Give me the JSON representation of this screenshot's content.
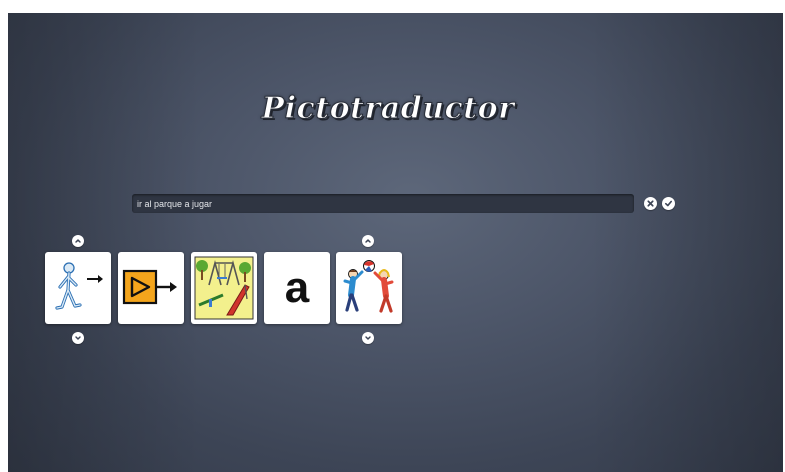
{
  "app": {
    "title": "Pictotraductor"
  },
  "search": {
    "value": "ir al parque a jugar"
  },
  "actions": {
    "clear_icon": "close-circle-icon",
    "confirm_icon": "check-circle-icon"
  },
  "pictograms": [
    {
      "name": "ir",
      "icon": "person-walking-arrow-icon"
    },
    {
      "name": "al",
      "icon": "play-arrow-icon"
    },
    {
      "name": "parque",
      "icon": "playground-icon"
    },
    {
      "name": "a",
      "label": "a"
    },
    {
      "name": "jugar",
      "icon": "children-playing-ball-icon"
    }
  ],
  "colors": {
    "background": "#4d5669",
    "search_bg": "#2f3542",
    "play_orange": "#f4a51c"
  }
}
